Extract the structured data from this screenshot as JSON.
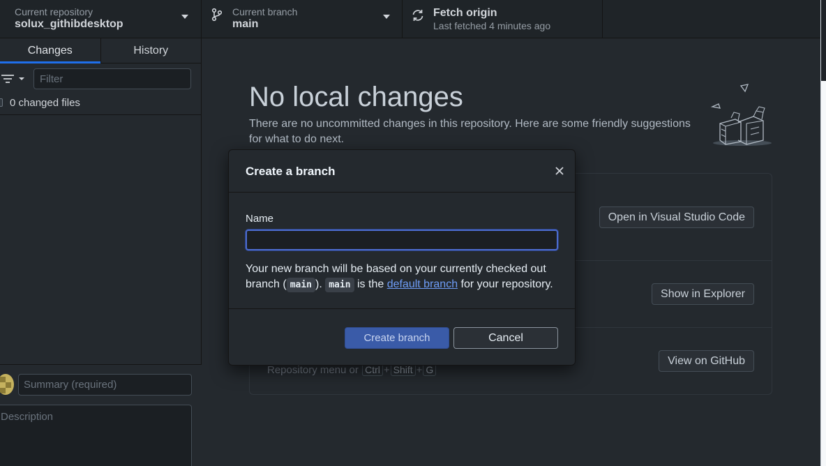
{
  "toolbar": {
    "repo_label": "Current repository",
    "repo_value": "solux_githibdesktop",
    "branch_label": "Current branch",
    "branch_value": "main",
    "fetch_label": "Fetch origin",
    "fetch_sub": "Last fetched 4 minutes ago"
  },
  "sidebar": {
    "tabs": [
      {
        "label": "Changes",
        "active": true
      },
      {
        "label": "History",
        "active": false
      }
    ],
    "filter_placeholder": "Filter",
    "changed_files": "0 changed files",
    "summary_placeholder": "Summary (required)",
    "description_placeholder": "Description"
  },
  "main": {
    "title": "No local changes",
    "description": "There are no uncommitted changes in this repository. Here are some friendly suggestions for what to do next.",
    "actions": [
      {
        "button": "Open in Visual Studio Code"
      },
      {
        "button": "Show in Explorer"
      },
      {
        "button": "View on GitHub",
        "hint_prefix": "Repository menu or",
        "keys": [
          "Ctrl",
          "Shift",
          "G"
        ]
      }
    ]
  },
  "dialog": {
    "title": "Create a branch",
    "name_label": "Name",
    "name_value": "",
    "note_1": "Your new branch will be based on your currently checked out branch (",
    "code_1": "main",
    "note_2": "). ",
    "code_2": "main",
    "note_3": " is the ",
    "link": "default branch",
    "note_4": " for your repository.",
    "primary_button": "Create branch",
    "cancel_button": "Cancel"
  },
  "colors": {
    "accent": "#1f6feb",
    "primary_button": "#3a5ba8",
    "link": "#6e9df7",
    "background": "#24292e"
  }
}
